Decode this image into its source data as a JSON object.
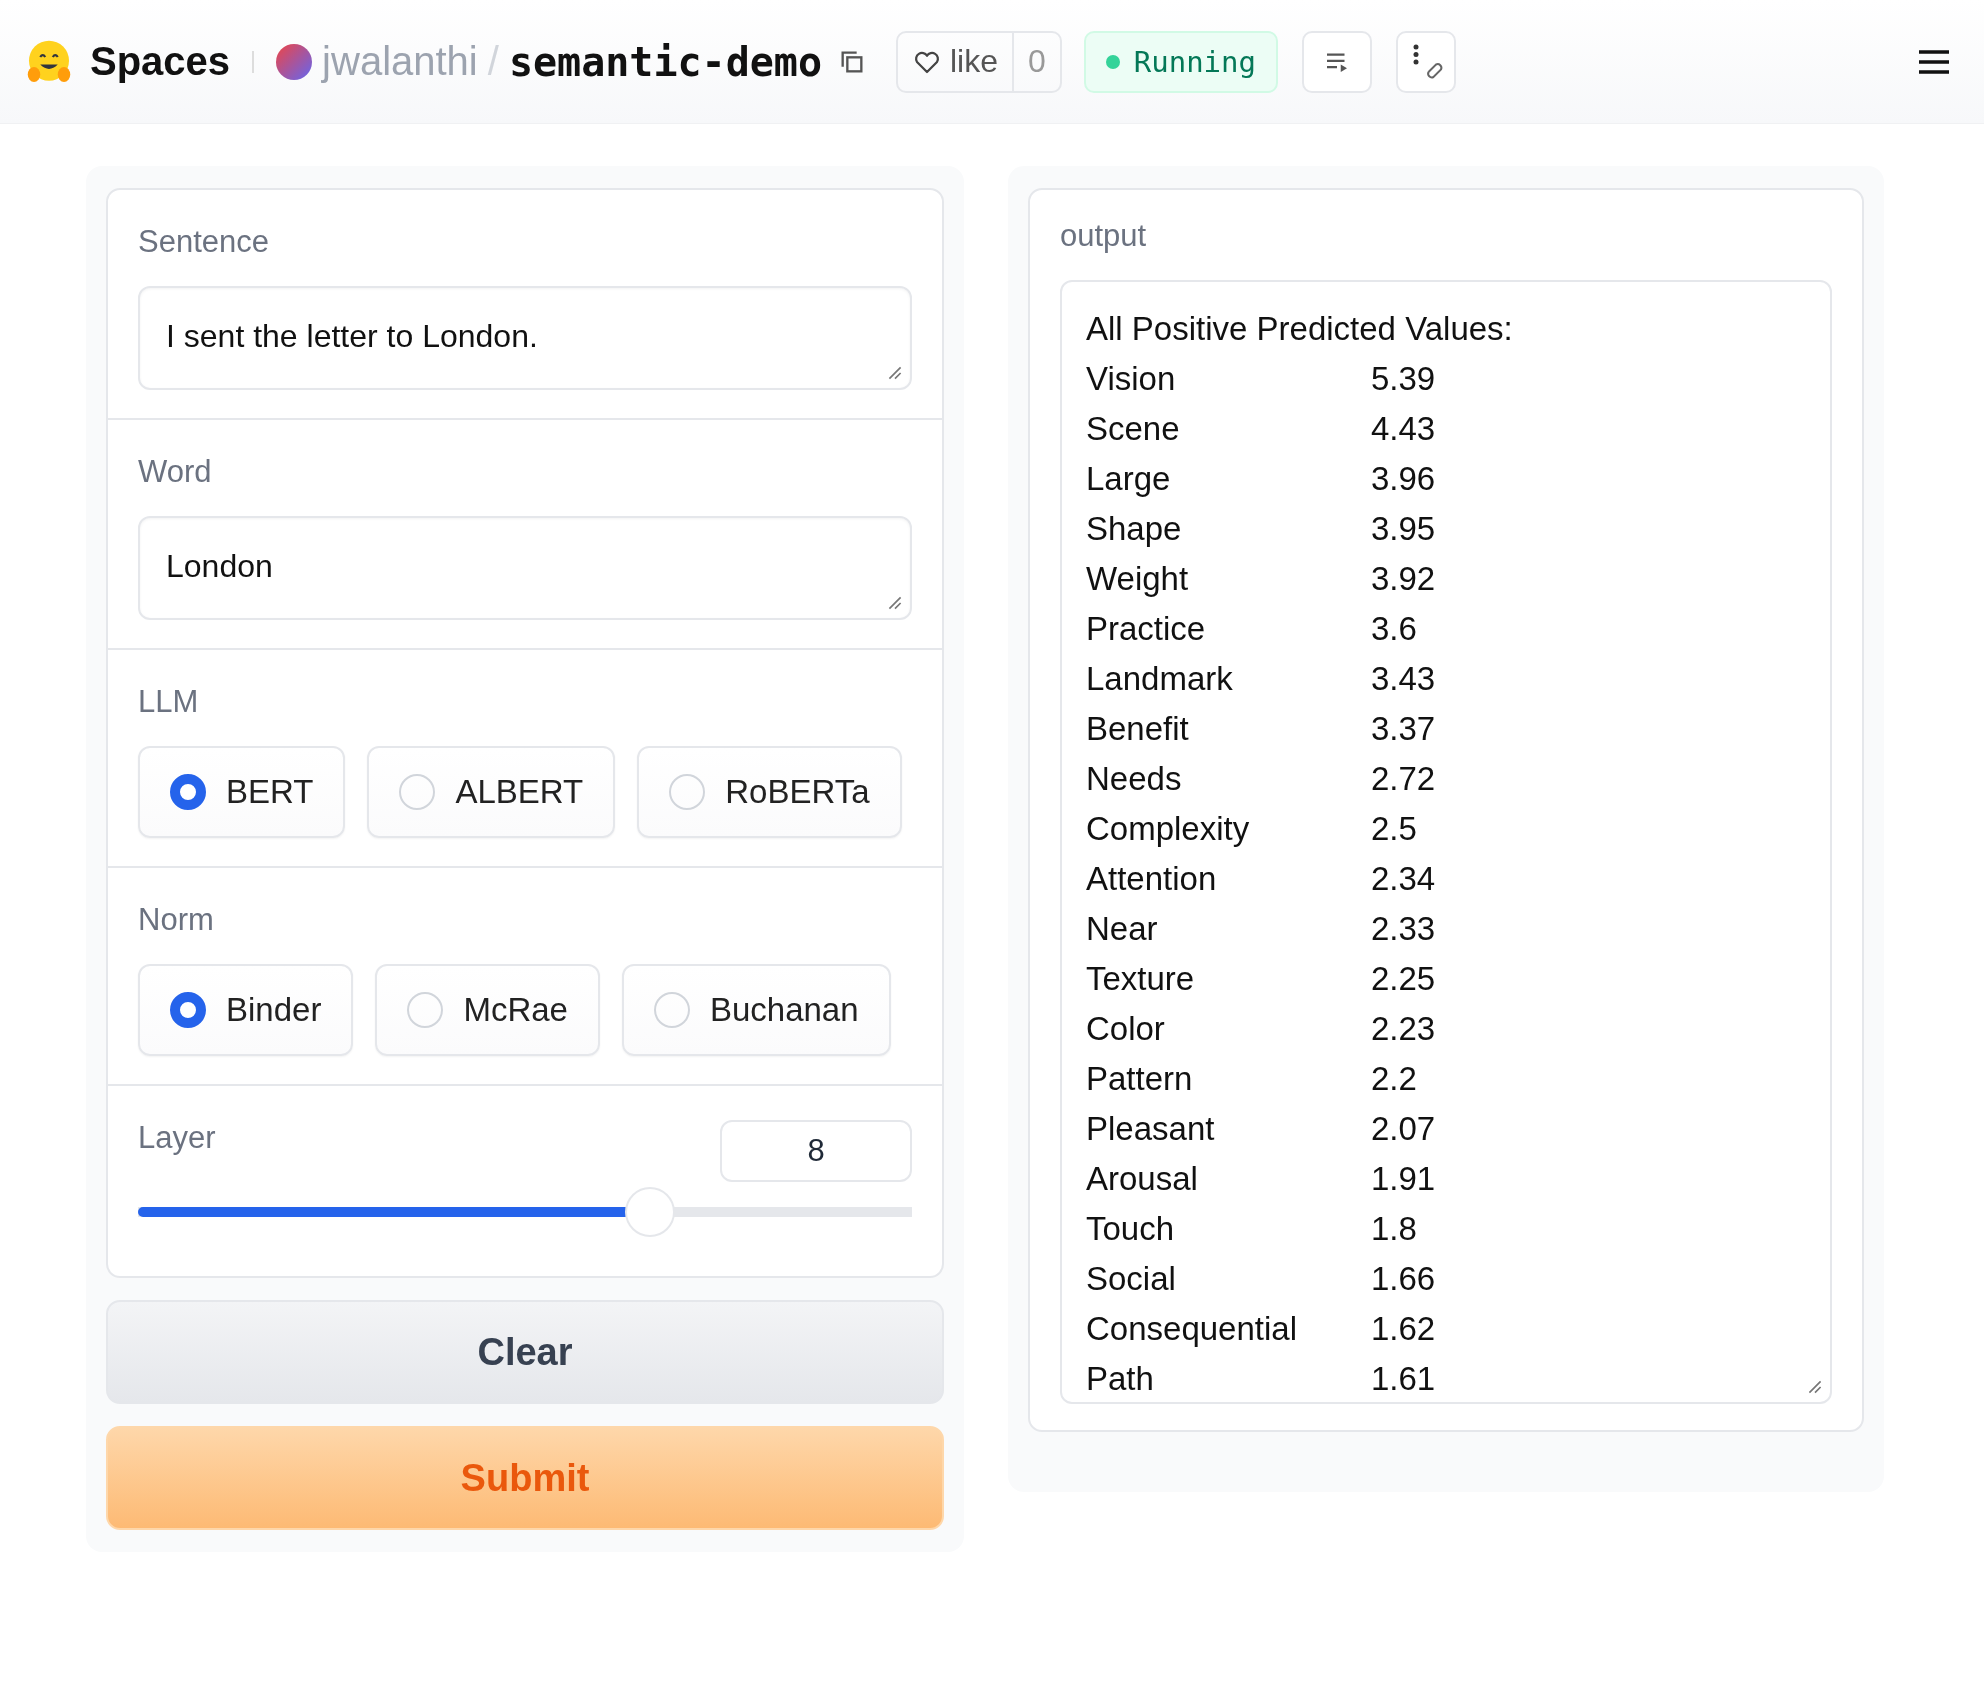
{
  "header": {
    "brand": "Spaces",
    "owner": "jwalanthi",
    "separator": "/",
    "repo": "semantic-demo",
    "like": {
      "label": "like",
      "count": "0"
    },
    "status": "Running"
  },
  "inputs": {
    "sentence": {
      "label": "Sentence",
      "value": "I sent the letter to London."
    },
    "word": {
      "label": "Word",
      "value": "London"
    },
    "llm": {
      "label": "LLM",
      "options": [
        {
          "label": "BERT",
          "selected": true
        },
        {
          "label": "ALBERT",
          "selected": false
        },
        {
          "label": "RoBERTa",
          "selected": false
        }
      ]
    },
    "norm": {
      "label": "Norm",
      "options": [
        {
          "label": "Binder",
          "selected": true
        },
        {
          "label": "McRae",
          "selected": false
        },
        {
          "label": "Buchanan",
          "selected": false
        }
      ]
    },
    "layer": {
      "label": "Layer",
      "value": "8",
      "level": 0.66
    },
    "buttons": {
      "clear": "Clear",
      "submit": "Submit"
    }
  },
  "output": {
    "label": "output",
    "heading": "All Positive Predicted Values:",
    "rows": [
      {
        "name": "Vision",
        "value": "5.39"
      },
      {
        "name": "Scene",
        "value": "4.43"
      },
      {
        "name": "Large",
        "value": "3.96"
      },
      {
        "name": "Shape",
        "value": "3.95"
      },
      {
        "name": "Weight",
        "value": "3.92"
      },
      {
        "name": "Practice",
        "value": "3.6"
      },
      {
        "name": "Landmark",
        "value": "3.43"
      },
      {
        "name": "Benefit",
        "value": "3.37"
      },
      {
        "name": "Needs",
        "value": "2.72"
      },
      {
        "name": "Complexity",
        "value": "2.5"
      },
      {
        "name": "Attention",
        "value": "2.34"
      },
      {
        "name": "Near",
        "value": "2.33"
      },
      {
        "name": "Texture",
        "value": "2.25"
      },
      {
        "name": "Color",
        "value": "2.23"
      },
      {
        "name": "Pattern",
        "value": "2.2"
      },
      {
        "name": "Pleasant",
        "value": "2.07"
      },
      {
        "name": "Arousal",
        "value": "1.91"
      },
      {
        "name": "Touch",
        "value": "1.8"
      },
      {
        "name": "Social",
        "value": "1.66"
      },
      {
        "name": "Consequential",
        "value": "1.62"
      },
      {
        "name": "Path",
        "value": "1.61"
      }
    ]
  }
}
